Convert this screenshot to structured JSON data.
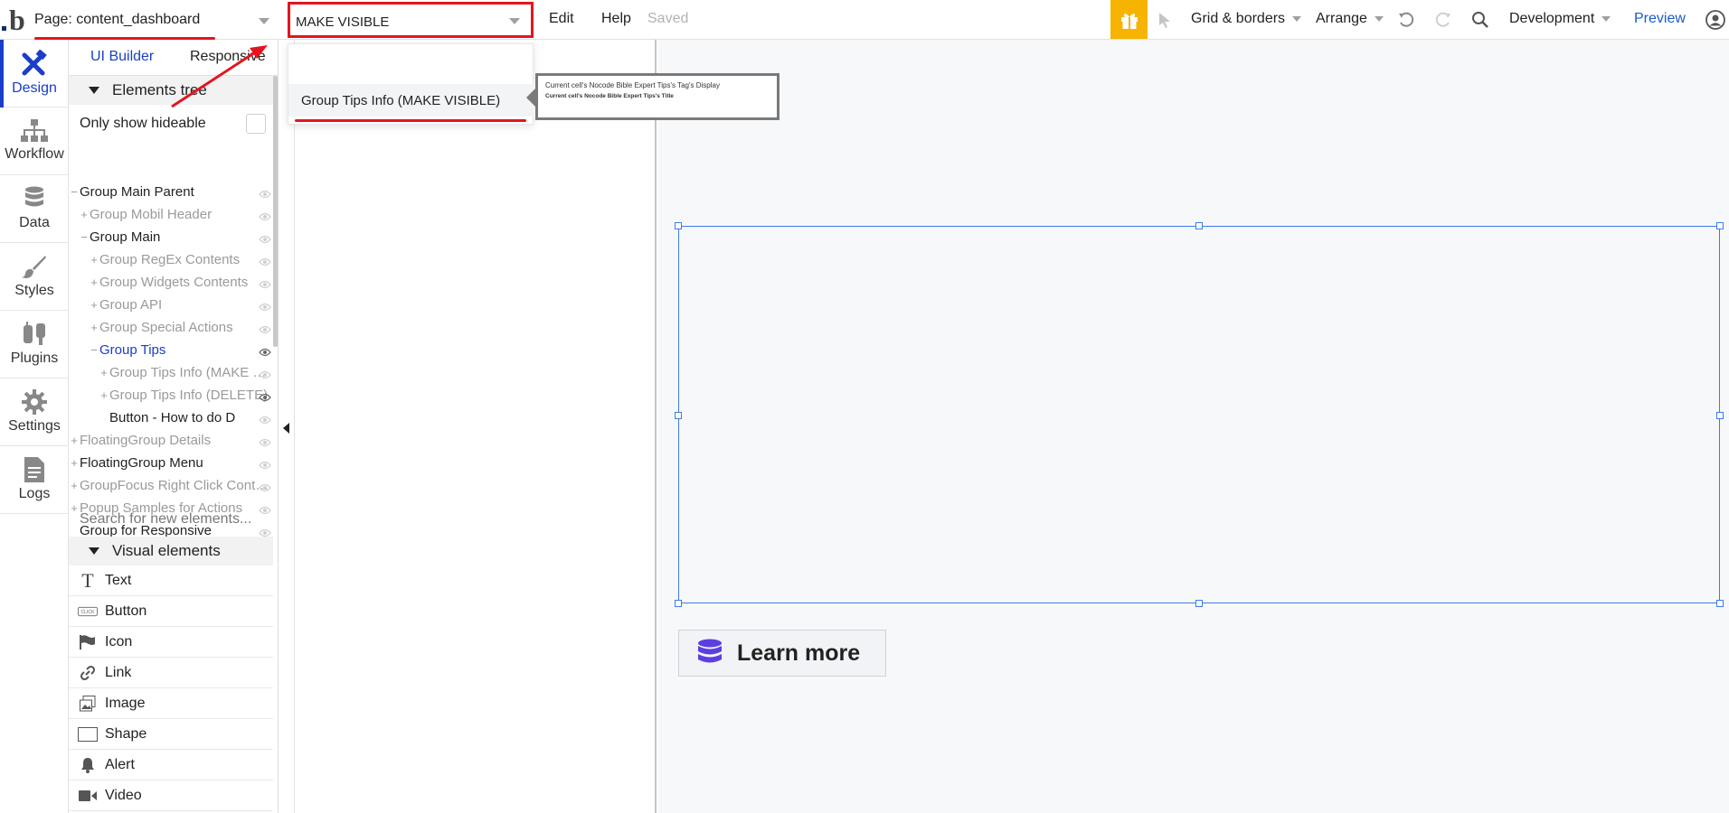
{
  "topbar": {
    "page_label": "Page: content_dashboard",
    "element_search_value": "MAKE VISIBLE",
    "menu": {
      "edit": "Edit",
      "help": "Help",
      "saved": "Saved"
    },
    "grid_borders": "Grid & borders",
    "arrange": "Arrange",
    "environment": "Development",
    "preview": "Preview",
    "icons": [
      "bubble-logo",
      "gift-icon",
      "pointer-icon",
      "undo-icon",
      "redo-icon",
      "search-icon",
      "user-icon"
    ],
    "accent_color": "#f6b300"
  },
  "leftnav": {
    "items": [
      {
        "label": "Design",
        "icon": "design-icon",
        "active": true
      },
      {
        "label": "Workflow",
        "icon": "workflow-icon",
        "active": false
      },
      {
        "label": "Data",
        "icon": "database-icon",
        "active": false
      },
      {
        "label": "Styles",
        "icon": "brush-icon",
        "active": false
      },
      {
        "label": "Plugins",
        "icon": "plug-icon",
        "active": false
      },
      {
        "label": "Settings",
        "icon": "gear-icon",
        "active": false
      },
      {
        "label": "Logs",
        "icon": "log-icon",
        "active": false
      }
    ]
  },
  "panel": {
    "tabs": {
      "ui_builder": "UI Builder",
      "responsive": "Responsive"
    },
    "elements_tree_title": "Elements tree",
    "only_show_hideable": "Only show hideable",
    "tree": [
      {
        "label": "Group Main Parent",
        "sign": "−",
        "indent": 0,
        "state": "normal"
      },
      {
        "label": "Group Mobil Header",
        "sign": "+",
        "indent": 1,
        "state": "dim"
      },
      {
        "label": "Group Main",
        "sign": "−",
        "indent": 1,
        "state": "normal"
      },
      {
        "label": "Group RegEx Contents",
        "sign": "+",
        "indent": 2,
        "state": "dim"
      },
      {
        "label": "Group Widgets Contents",
        "sign": "+",
        "indent": 2,
        "state": "dim"
      },
      {
        "label": "Group API",
        "sign": "+",
        "indent": 2,
        "state": "dim"
      },
      {
        "label": "Group Special Actions",
        "sign": "+",
        "indent": 2,
        "state": "dim"
      },
      {
        "label": "Group Tips",
        "sign": "−",
        "indent": 2,
        "state": "selected"
      },
      {
        "label": "Group Tips Info (MAKE VISIBLE)",
        "sign": "+",
        "indent": 3,
        "state": "dim"
      },
      {
        "label": "Group Tips Info (DELETE)",
        "sign": "+",
        "indent": 3,
        "state": "dim"
      },
      {
        "label": "Button - How to do D",
        "sign": "",
        "indent": 3,
        "state": "normal"
      },
      {
        "label": "FloatingGroup Details",
        "sign": "+",
        "indent": 0,
        "state": "dim"
      },
      {
        "label": "FloatingGroup Menu",
        "sign": "+",
        "indent": 0,
        "state": "normal"
      },
      {
        "label": "GroupFocus Right Click Context",
        "sign": "+",
        "indent": 0,
        "state": "dim"
      },
      {
        "label": "Popup Samples for Actions",
        "sign": "+",
        "indent": 0,
        "state": "dim"
      },
      {
        "label": "Group for Responsive",
        "sign": "",
        "indent": 0,
        "state": "normal"
      }
    ],
    "search_new_placeholder": "Search for new elements...",
    "visual_elements_title": "Visual elements",
    "visual_elements": [
      {
        "label": "Text",
        "icon": "text-icon"
      },
      {
        "label": "Button",
        "icon": "button-icon"
      },
      {
        "label": "Icon",
        "icon": "flag-icon"
      },
      {
        "label": "Link",
        "icon": "link-icon"
      },
      {
        "label": "Image",
        "icon": "image-icon"
      },
      {
        "label": "Shape",
        "icon": "shape-icon"
      },
      {
        "label": "Alert",
        "icon": "bell-icon"
      },
      {
        "label": "Video",
        "icon": "video-icon"
      }
    ]
  },
  "dropdown": {
    "result": "Group Tips Info (MAKE VISIBLE)"
  },
  "tooltip": {
    "line1": "Current cell's Nocode Bible Expert Tips's Tag's Display",
    "line2": "Current cell's Nocode Bible Expert Tips's Title"
  },
  "canvas": {
    "learn_more": "Learn more",
    "selection_color": "#3d7ce8"
  },
  "annotation_color": "#e4141f"
}
